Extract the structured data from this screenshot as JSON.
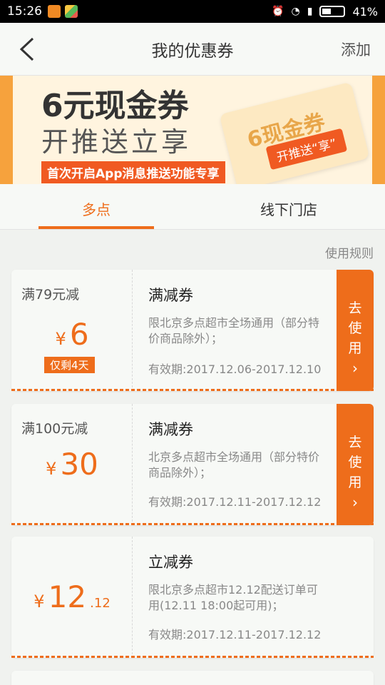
{
  "status": {
    "time": "15:26",
    "battery": "41%"
  },
  "nav": {
    "title": "我的优惠券",
    "add": "添加"
  },
  "banner": {
    "title": "6元现金券",
    "subtitle": "开推送立享",
    "strip": "首次开启App消息推送功能专享",
    "card_text": "6现金券",
    "card_btn": "开推送“享”"
  },
  "tabs": [
    {
      "label": "多点"
    },
    {
      "label": "线下门店"
    }
  ],
  "rules": "使用规则",
  "coupons": [
    {
      "condition": "满79元减",
      "yen": "¥",
      "amount": "6",
      "decimal": "",
      "remaining": "仅剩4天",
      "type": "满减券",
      "desc": "限北京多点超市全场通用（部分特价商品除外）；",
      "validity": "有效期:2017.12.06-2017.12.10",
      "use": "去使用"
    },
    {
      "condition": "满100元减",
      "yen": "¥",
      "amount": "30",
      "decimal": "",
      "type": "满减券",
      "desc": "北京多点超市全场通用（部分特价商品除外）；",
      "validity": "有效期:2017.12.11-2017.12.12",
      "use": "去使用"
    },
    {
      "condition": "",
      "yen": "¥",
      "amount": "12",
      "decimal": ".12",
      "type": "立减券",
      "desc": "限北京多点超市12.12配送订单可用(12.11 18:00起可用)；",
      "validity": "有效期:2017.12.11-2017.12.12"
    }
  ]
}
